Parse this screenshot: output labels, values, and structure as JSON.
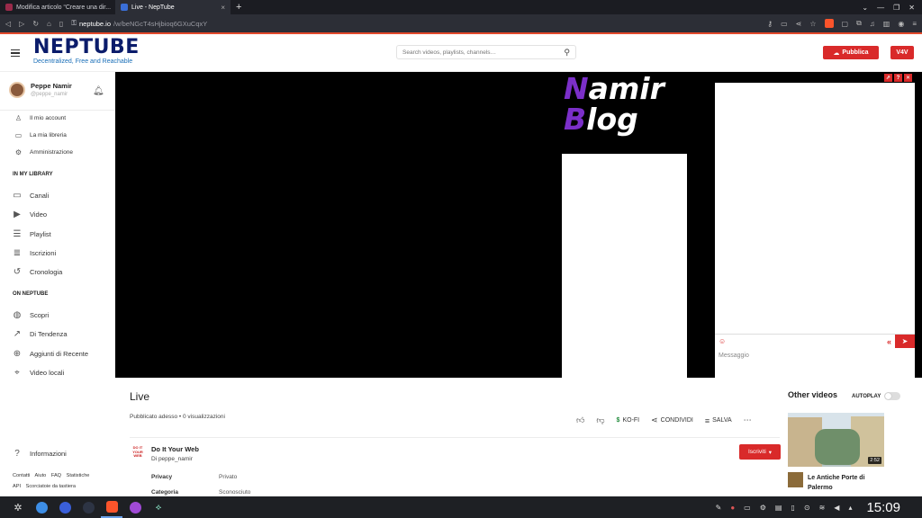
{
  "browser": {
    "tabs": [
      {
        "title": "Modifica articolo “Creare una dir...",
        "active": false
      },
      {
        "title": "Live - NepTube",
        "active": true
      }
    ],
    "new_tab": "+",
    "url_host": "neptube.io",
    "url_path": "/w/beNGcT4sHjbioq6GXuCqxY"
  },
  "header": {
    "logo_text": "NEPTUBE",
    "tagline": "Decentralized, Free and Reachable",
    "search_placeholder": "Search videos, playlists, channels…",
    "publish_label": "Pubblica",
    "v4v_label": "V4V"
  },
  "sidebar": {
    "user_name": "Peppe Namir",
    "user_handle": "@peppe_namir",
    "account_items": [
      {
        "icon": "user-icon",
        "label": "Il mio account"
      },
      {
        "icon": "folder-icon",
        "label": "La mia libreria"
      },
      {
        "icon": "cog-icon",
        "label": "Amministrazione"
      }
    ],
    "library_heading": "IN MY LIBRARY",
    "library_items": [
      {
        "icon": "channels-icon",
        "label": "Canali"
      },
      {
        "icon": "video-icon",
        "label": "Video"
      },
      {
        "icon": "playlist-icon",
        "label": "Playlist"
      },
      {
        "icon": "subscriptions-icon",
        "label": "Iscrizioni"
      },
      {
        "icon": "history-icon",
        "label": "Cronologia"
      }
    ],
    "neptube_heading": "ON NEPTUBE",
    "neptube_items": [
      {
        "icon": "globe-icon",
        "label": "Scopri"
      },
      {
        "icon": "trending-icon",
        "label": "Di Tendenza"
      },
      {
        "icon": "plus-circle-icon",
        "label": "Aggiunti di Recente"
      },
      {
        "icon": "location-icon",
        "label": "Video locali"
      }
    ],
    "info_label": "Informazioni",
    "footer_links_1": [
      "Contatti",
      "Aiuto",
      "FAQ",
      "Statistiche"
    ],
    "footer_links_2": [
      "API",
      "Scorciatoie da tastiera"
    ]
  },
  "player": {
    "overlay_line1_cap": "N",
    "overlay_line1_rest": "amir",
    "overlay_line2_cap": "B",
    "overlay_line2_rest": "log",
    "chat_placeholder": "Messaggio"
  },
  "video": {
    "title": "Live",
    "meta": "Pubblicato adesso • 0 visualizzazioni",
    "kofi_label": "KO-FI",
    "share_label": "CONDIVIDI",
    "save_label": "SALVA",
    "channel_logo_text": "DO IT YOUR WEB",
    "channel_name": "Do It Your Web",
    "channel_by": "Di peppe_namir",
    "subscribe_label": "Iscriviti",
    "info": [
      {
        "key": "Privacy",
        "value": "Privato"
      },
      {
        "key": "Categoria",
        "value": "Sconosciuto"
      }
    ]
  },
  "related": {
    "heading": "Other videos",
    "autoplay_label": "AUTOPLAY",
    "autoplay_on": false,
    "items": [
      {
        "title": "Le Antiche Porte di Palermo",
        "duration": "2:52"
      }
    ]
  },
  "taskbar": {
    "time": "15:09"
  },
  "colors": {
    "brand_red": "#d92a2a",
    "logo_navy": "#0b1c6b",
    "overlay_purple": "#7b2fc9"
  }
}
